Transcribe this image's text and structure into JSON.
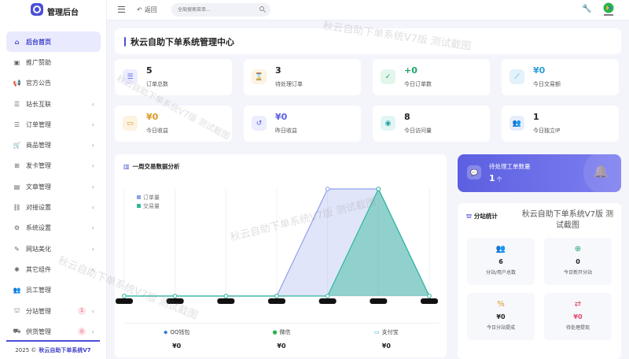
{
  "brand": {
    "title": "管理后台"
  },
  "sidebar": {
    "items": [
      {
        "label": "后台首页",
        "icon": "home-icon",
        "active": true
      },
      {
        "label": "推广赞助",
        "icon": "image-icon"
      },
      {
        "label": "官方公告",
        "icon": "megaphone-icon"
      },
      {
        "label": "站长互联",
        "icon": "list-icon",
        "arrow": "‹"
      },
      {
        "label": "订单管理",
        "icon": "list-icon",
        "arrow": "‹"
      },
      {
        "label": "商品管理",
        "icon": "cart-icon",
        "arrow": "‹"
      },
      {
        "label": "发卡管理",
        "icon": "grid-icon",
        "arrow": "‹"
      },
      {
        "label": "文章管理",
        "icon": "document-icon",
        "arrow": "‹"
      },
      {
        "label": "对接设置",
        "icon": "link-icon",
        "arrow": "‹"
      },
      {
        "label": "系统设置",
        "icon": "gear-icon",
        "arrow": "‹"
      },
      {
        "label": "网站美化",
        "icon": "brush-icon",
        "arrow": "‹"
      },
      {
        "label": "其它组件",
        "icon": "puzzle-icon",
        "arrow": "‹"
      },
      {
        "label": "员工管理",
        "icon": "users-icon"
      },
      {
        "label": "分站管理",
        "icon": "sitemap-icon",
        "arrow": "‹",
        "badge": "1"
      },
      {
        "label": "供货管理",
        "icon": "truck-icon",
        "arrow": "‹",
        "badge": "0"
      }
    ],
    "footer_prefix": "2025 ©",
    "footer_name": "秋云自助下单系统V7"
  },
  "header": {
    "back_label": "返回",
    "search_placeholder": "全局搜索菜单..."
  },
  "main": {
    "title": "秋云自助下单系统管理中心",
    "stats": [
      {
        "value": "5",
        "label": "订单总数",
        "icon": "list-icon",
        "color": "#5a5fe0",
        "bg": "#ecedfd"
      },
      {
        "value": "3",
        "label": "待处理订单",
        "icon": "hourglass-icon",
        "color": "#d99a22",
        "bg": "#fdf3e1"
      },
      {
        "value": "+0",
        "label": "今日订单数",
        "icon": "calendar-check-icon",
        "color": "#21a36b",
        "bg": "#e3f6ec",
        "value_color": "#21a36b"
      },
      {
        "value": "¥0",
        "label": "今日交易额",
        "icon": "chart-line-icon",
        "color": "#2d9fd8",
        "bg": "#e3f2fb",
        "value_color": "#2d9fd8"
      },
      {
        "value": "¥0",
        "label": "今日收益",
        "icon": "money-icon",
        "color": "#d99a22",
        "bg": "#fdf3e1",
        "value_color": "#d99a22"
      },
      {
        "value": "¥0",
        "label": "昨日收益",
        "icon": "history-icon",
        "color": "#5a5fe0",
        "bg": "#ecedfd",
        "value_color": "#5a5fe0"
      },
      {
        "value": "8",
        "label": "今日访问量",
        "icon": "eye-icon",
        "color": "#21a3a3",
        "bg": "#e2f6f5"
      },
      {
        "value": "1",
        "label": "今日独立IP",
        "icon": "users-icon",
        "color": "#4a7ad8",
        "bg": "#e7eefb"
      }
    ]
  },
  "chart_data": {
    "type": "area",
    "title": "一周交易数据分析",
    "categories": [
      "",
      "",
      "",
      "",
      "",
      "",
      ""
    ],
    "series": [
      {
        "name": "订单量",
        "color": "#8fa0e8",
        "values": [
          0,
          0,
          0,
          0,
          5,
          5,
          0
        ]
      },
      {
        "name": "交易量",
        "color": "#2fb89a",
        "values": [
          0,
          0,
          0,
          0,
          0,
          5,
          0
        ]
      }
    ],
    "ylim": [
      0,
      5
    ],
    "grid": true,
    "legend": "top-left"
  },
  "payments": [
    {
      "name": "QQ钱包",
      "value": "¥0",
      "icon": "qq-icon",
      "color": "#3a7bd5"
    },
    {
      "name": "微信",
      "value": "¥0",
      "icon": "wechat-icon",
      "color": "#2bb24c"
    },
    {
      "name": "支付宝",
      "value": "¥0",
      "icon": "alipay-icon",
      "color": "#2d9fd8"
    }
  ],
  "pending": {
    "label": "待处理工单数量",
    "value": "1",
    "unit": "个"
  },
  "substation": {
    "title": "分站统计",
    "watermark_text": "秋云自助下单系统V7版 测试截图",
    "items": [
      {
        "value": "6",
        "label": "分站/用户总数",
        "icon": "users-icon",
        "color": "#5a5fe0"
      },
      {
        "value": "0",
        "label": "今日新开分站",
        "icon": "plus-circle-icon",
        "color": "#21a36b"
      },
      {
        "value": "¥0",
        "label": "今日分站提成",
        "icon": "percent-icon",
        "color": "#d99a22"
      },
      {
        "value": "¥0",
        "label": "待处理提现",
        "icon": "exchange-icon",
        "color": "#e04a6a",
        "value_color": "#e04a6a"
      }
    ]
  },
  "watermark": "秋云自助下单系统V7版 测试截图"
}
